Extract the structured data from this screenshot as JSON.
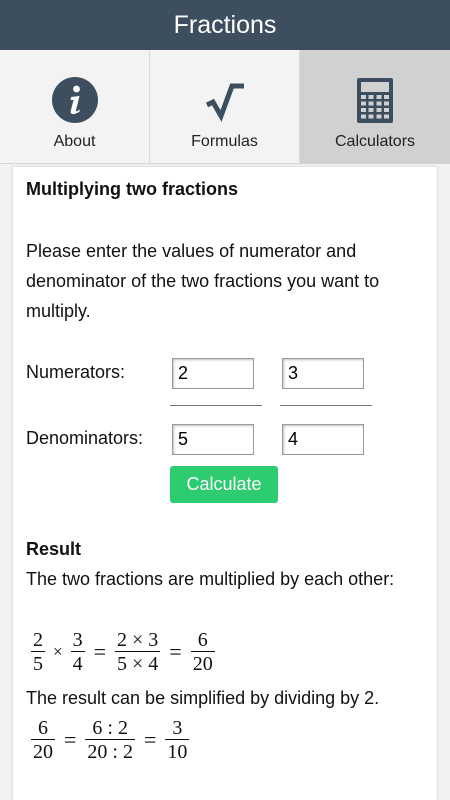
{
  "app": {
    "title": "Fractions"
  },
  "tabs": [
    {
      "label": "About",
      "icon": "info-icon"
    },
    {
      "label": "Formulas",
      "icon": "square-root-icon"
    },
    {
      "label": "Calculators",
      "icon": "calculator-icon",
      "active": true
    }
  ],
  "form": {
    "title": "Multiplying two fractions",
    "intro": "Please enter the values of numerator and denominator of the two fractions you want to multiply.",
    "numerators_label": "Numerators:",
    "denominators_label": "Denominators:",
    "numerator1": "2",
    "numerator2": "3",
    "denominator1": "5",
    "denominator2": "4",
    "calculate_label": "Calculate"
  },
  "result": {
    "heading": "Result",
    "text1": "The two fractions are multiplied by each other:",
    "eq1": {
      "f1_n": "2",
      "f1_d": "5",
      "times": "×",
      "f2_n": "3",
      "f2_d": "4",
      "eq": "=",
      "prod_n": "2 × 3",
      "prod_d": "5 × 4",
      "res_n": "6",
      "res_d": "20"
    },
    "text2": "The result can be simplified by dividing by 2.",
    "eq2": {
      "f_n": "6",
      "f_d": "20",
      "eq": "=",
      "div_n": "6 : 2",
      "div_d": "20 : 2",
      "res_n": "3",
      "res_d": "10"
    }
  },
  "colors": {
    "titlebar": "#3d4f5f",
    "active_tab": "#d1d1d1",
    "calculate_button": "#2ecc71",
    "icon_dark": "#3d4f5f"
  }
}
